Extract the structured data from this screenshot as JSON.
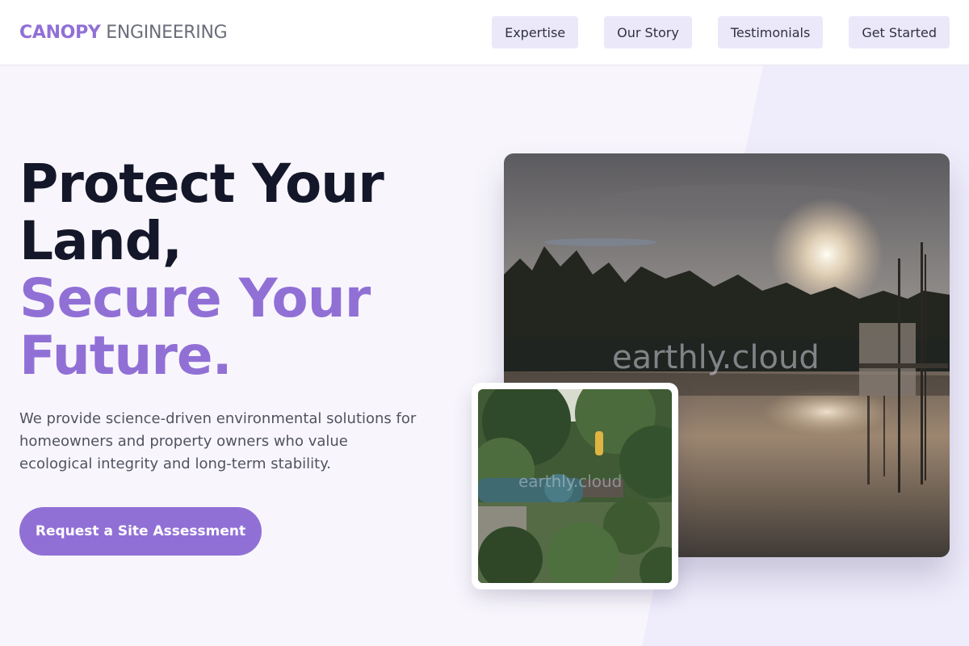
{
  "header": {
    "brand_primary": "CANOPY",
    "brand_secondary": "ENGINEERING",
    "nav": [
      {
        "label": "Expertise"
      },
      {
        "label": "Our Story"
      },
      {
        "label": "Testimonials"
      },
      {
        "label": "Get Started"
      }
    ]
  },
  "hero": {
    "title_line1": "Protect Your",
    "title_line2": "Land,",
    "title_accent_line1": "Secure Your",
    "title_accent_line2": "Future.",
    "description": "We provide science-driven environmental solutions for homeowners and property owners who value ecological integrity and long-term stability.",
    "cta_label": "Request a Site Assessment"
  },
  "images": {
    "main_watermark": "earthly.cloud",
    "inset_watermark": "earthly.cloud"
  },
  "colors": {
    "accent": "#9170d6",
    "heading": "#141729",
    "nav_bg": "#ebe8fa",
    "page_bg": "#f8f6fc"
  }
}
